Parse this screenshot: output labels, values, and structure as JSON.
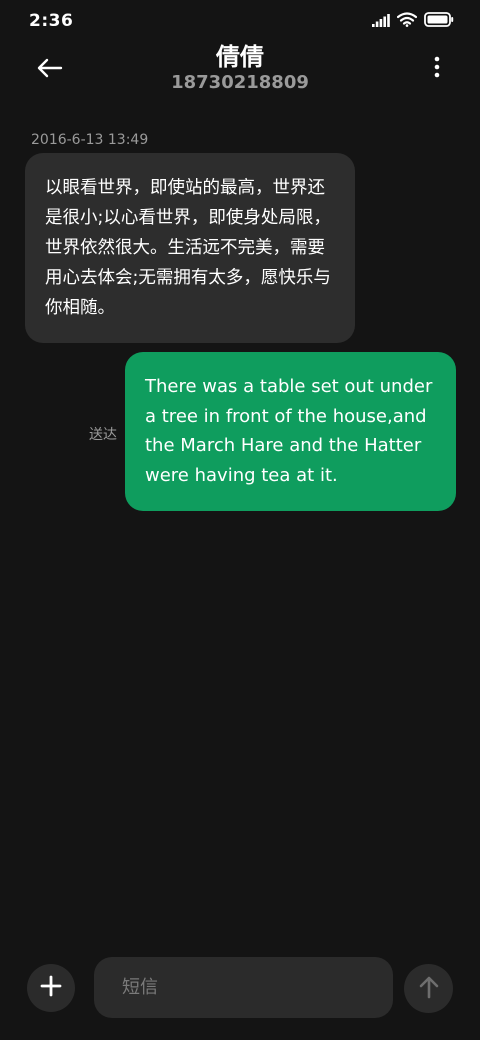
{
  "status_bar": {
    "time": "2:36",
    "icons": [
      "signal-icon",
      "wifi-icon",
      "battery-icon"
    ]
  },
  "header": {
    "back_icon": "arrow-left-icon",
    "contact_name": "倩倩",
    "contact_number": "18730218809",
    "more_icon": "more-vertical-icon"
  },
  "conversation": {
    "timestamp": "2016-6-13 13:49",
    "received_message": "以眼看世界，即使站的最高，世界还是很小;以心看世界，即使身处局限，世界依然很大。生活远不完美，需要用心去体会;无需拥有太多，愿快乐与你相随。",
    "sent_message": "There was a table set out under a tree in front of the house,and the March Hare and the Hatter were having tea at it.",
    "sent_status": "送达"
  },
  "composer": {
    "add_icon": "plus-icon",
    "placeholder": "短信",
    "value": "",
    "send_icon": "arrow-up-icon"
  },
  "colors": {
    "background": "#141414",
    "received_bubble": "#2d2d2d",
    "sent_bubble": "#0f9d5e",
    "secondary_text": "#9a9a9a",
    "button_bg": "#2b2b2b"
  }
}
